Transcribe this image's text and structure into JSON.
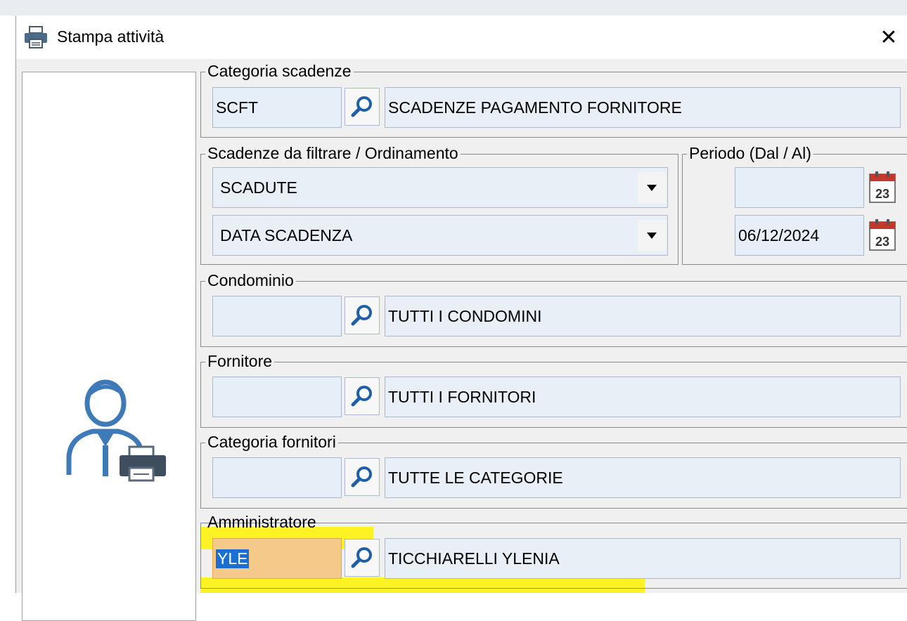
{
  "window": {
    "title": "Stampa attività",
    "close_glyph": "✕",
    "title_icon": "printer-icon"
  },
  "panel_icon": "user-printer-icon",
  "groups": {
    "categoria_scadenze": {
      "legend": "Categoria scadenze",
      "code": "SCFT",
      "description": "SCADENZE PAGAMENTO FORNITORE"
    },
    "filtro": {
      "legend": "Scadenze da filtrare / Ordinamento",
      "select1": "SCADUTE",
      "select2": "DATA SCADENZA"
    },
    "periodo": {
      "legend": "Periodo (Dal / Al)",
      "dal": "",
      "al": "06/12/2024",
      "calendar_day": "23"
    },
    "condominio": {
      "legend": "Condominio",
      "code": "",
      "description": "TUTTI I CONDOMINI"
    },
    "fornitore": {
      "legend": "Fornitore",
      "code": "",
      "description": "TUTTI I FORNITORI"
    },
    "categoria_fornitori": {
      "legend": "Categoria fornitori",
      "code": "",
      "description": "TUTTE LE CATEGORIE"
    },
    "amministratore": {
      "legend": "Amministratore",
      "code": "YLE",
      "description": "TICCHIARELLI YLENIA"
    }
  },
  "colors": {
    "highlight": "#fff200",
    "selection": "#1a6fd1",
    "field_bg": "#e6eef7",
    "icon_blue": "#3f7ab8"
  }
}
